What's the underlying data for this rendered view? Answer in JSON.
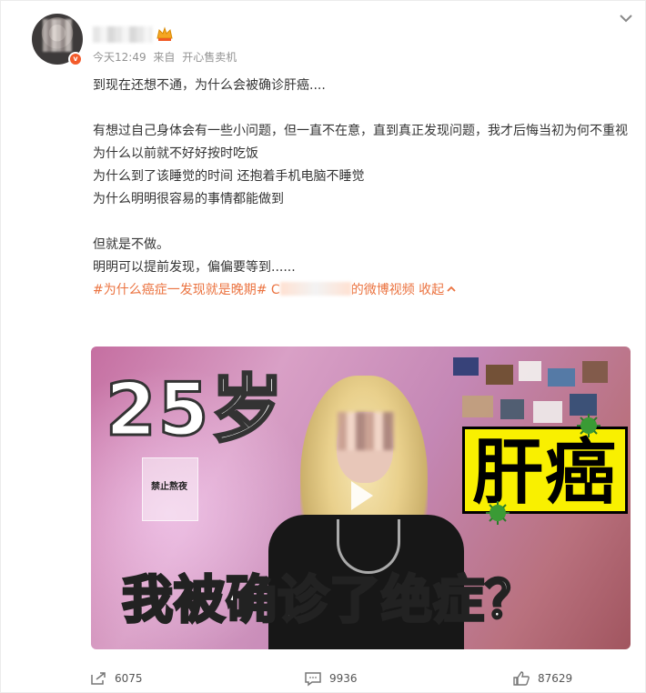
{
  "post": {
    "time": "今天12:49",
    "source_prefix": "来自",
    "source": "开心售卖机",
    "verified_badge": "v",
    "content": {
      "line1": "到现在还想不通，为什么会被确诊肝癌....",
      "line2": "有想过自己身体会有一些小问题，但一直不在意，直到真正发现问题，我才后悔当初为何不重视",
      "line3": "为什么以前就不好好按时吃饭",
      "line4": "为什么到了该睡觉的时间 还抱着手机电脑不睡觉",
      "line5": "为什么明明很容易的事情都能做到",
      "line6": "但就是不做。",
      "line7": "明明可以提前发现，偏偏要等到......",
      "topic": "#为什么癌症一发现就是晚期#",
      "topic_prefix": "C",
      "video_link": "的微博视频",
      "collapse": "收起"
    },
    "video": {
      "age_text": "25岁",
      "liver_text": "肝癌",
      "caption_text": "我被确诊了绝症？",
      "bag_text": "禁止熬夜"
    }
  },
  "actions": {
    "repost": "6075",
    "comment": "9936",
    "like": "87629"
  },
  "colors": {
    "accent": "#eb7340",
    "text": "#333333",
    "meta": "#939393",
    "badge": "#f35b2b"
  },
  "icons": {
    "chevron": "chevron-down-icon",
    "crown": "crown-icon",
    "repost": "repost-icon",
    "comment": "comment-icon",
    "like": "like-icon",
    "play": "play-icon"
  }
}
